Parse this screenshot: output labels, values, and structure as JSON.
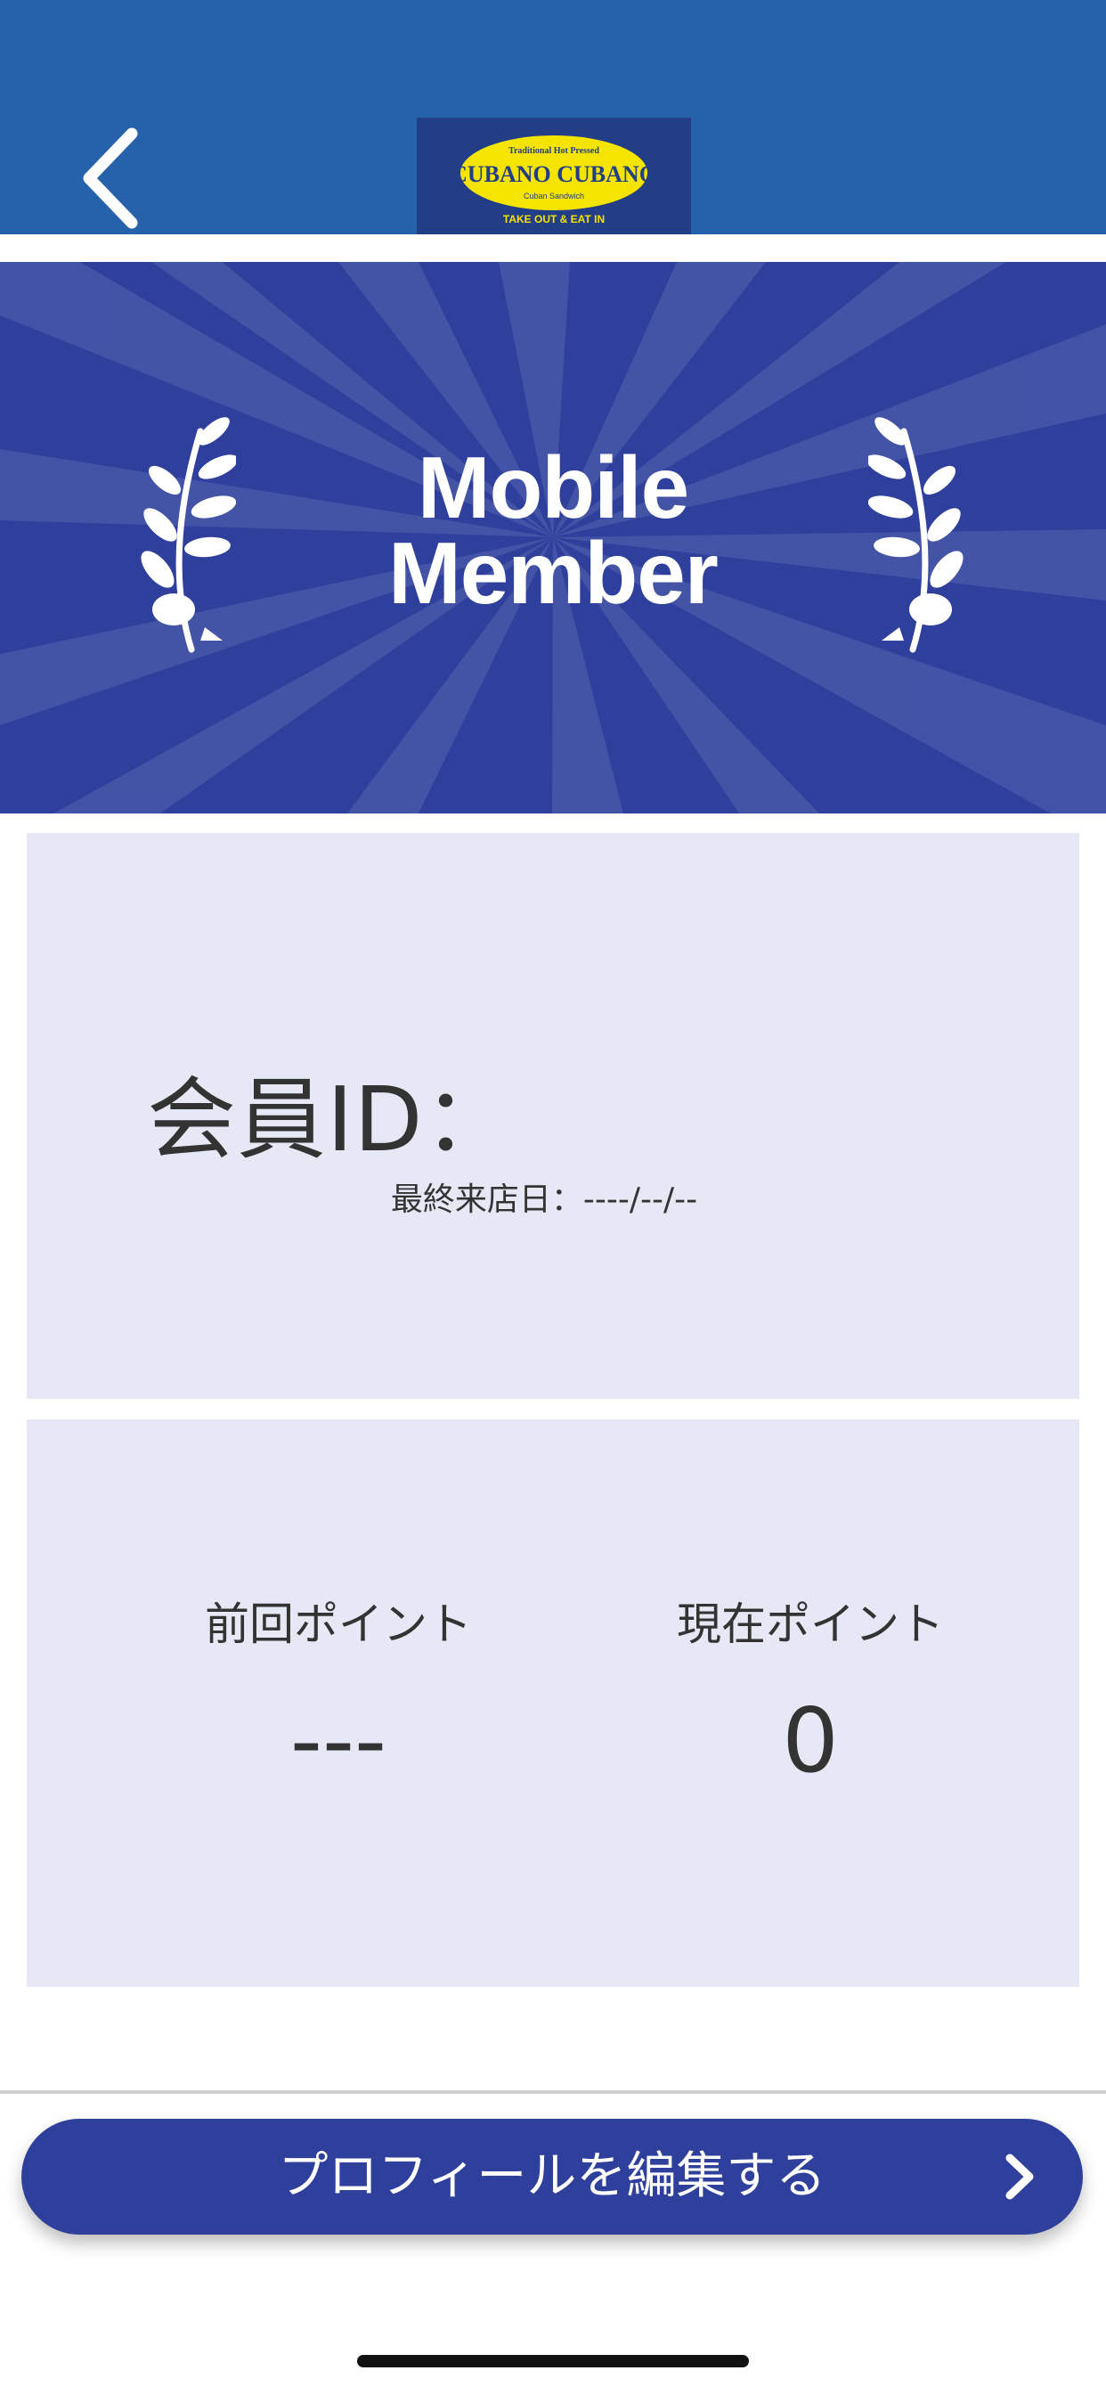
{
  "header": {
    "back_icon": "chevron-left-icon",
    "logo": {
      "top_text": "Traditional Hot Pressed",
      "brand": "CUBANO CUBANO",
      "sub_text": "Cuban Sandwich",
      "bottom_text": "TAKE OUT & EAT IN"
    }
  },
  "hero": {
    "title_line1": "Mobile",
    "title_line2": "Member",
    "left_icon": "laurel-branch-icon",
    "right_icon": "laurel-branch-icon"
  },
  "member": {
    "id_label": "会員ID：",
    "id_value": "",
    "last_visit": "最終来店日：----/--/--"
  },
  "points": {
    "previous_label": "前回ポイント",
    "previous_value": "---",
    "current_label": "現在ポイント",
    "current_value": "0"
  },
  "actions": {
    "edit_profile_label": "プロフィールを編集する",
    "edit_profile_icon": "chevron-right-icon"
  },
  "colors": {
    "header_bg": "#2562a9",
    "primary": "#2f3f9c",
    "card_bg": "#e6e8f5",
    "logo_yellow": "#f5e400"
  }
}
